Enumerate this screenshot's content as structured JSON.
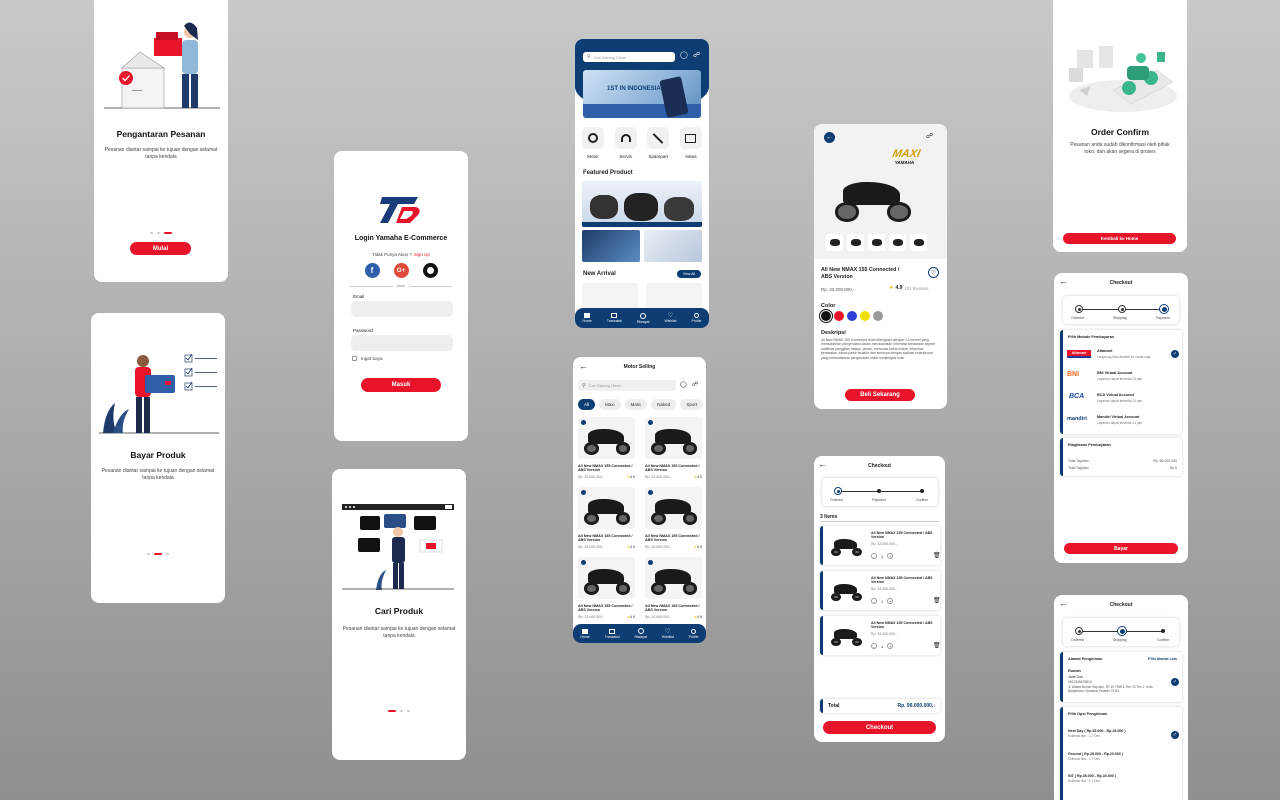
{
  "onboard1": {
    "title": "Pengantaran Pesanan",
    "desc": "Pesanan diantar sampai ke tujuan dengan selamat tanpa kendala",
    "button": "Mulai"
  },
  "onboard2": {
    "title": "Bayar Produk",
    "desc": "Pesanan diantar sampai ke tujuan dengan selamat tanpa kendala"
  },
  "onboard3": {
    "title": "Cari Produk",
    "desc": "Pesanan diantar sampai ke tujuan dengan selamat tanpa kendala"
  },
  "login": {
    "title": "Login Yamaha E-Commerce",
    "no_account": "Tidak Punya Akun ?",
    "signup": "Sign Up",
    "or": "Atau",
    "email_label": "Email",
    "password_label": "Password",
    "remember": "Ingat Saya",
    "button": "Masuk"
  },
  "home": {
    "search_placeholder": "Cari Barang Disini",
    "banner_text": "1ST IN INDONESIA",
    "categories": [
      {
        "label": "Motor",
        "icon": "motorcycle-icon"
      },
      {
        "label": "Servis",
        "icon": "headset-icon"
      },
      {
        "label": "Sparepart",
        "icon": "wrench-icon"
      },
      {
        "label": "News",
        "icon": "newspaper-icon"
      }
    ],
    "featured_title": "Featured Product",
    "new_arrival_title": "New Arrival",
    "view_all": "View All",
    "nav": [
      "Home",
      "Transaksi",
      "Riwayat",
      "Wishlist",
      "Profile"
    ]
  },
  "listing": {
    "title": "Motor Selling",
    "search_placeholder": "Cari Barang Disini",
    "filters": [
      "All",
      "Maxi",
      "Matic",
      "Naked",
      "Sport"
    ],
    "products": [
      {
        "name": "All New NMAX 155 Connected / ABS Version",
        "price": "Rp. 32.000.000,-",
        "rating": "4.9"
      },
      {
        "name": "All New NMAX 155 Connected / ABS Version",
        "price": "Rp. 32.000.000,-",
        "rating": "4.9"
      },
      {
        "name": "All New NMAX 155 Connected / ABS Version",
        "price": "Rp. 32.000.000,-",
        "rating": "4.9"
      },
      {
        "name": "All New NMAX 155 Connected / ABS Version",
        "price": "Rp. 32.000.000,-",
        "rating": "4.9"
      },
      {
        "name": "All New NMAX 155 Connected / ABS Version",
        "price": "Rp. 32.000.000,-",
        "rating": "4.9"
      },
      {
        "name": "All New NMAX 155 Connected / ABS Version",
        "price": "Rp. 32.000.000,-",
        "rating": "4.9"
      }
    ],
    "nav": [
      "Home",
      "Transaksi",
      "Riwayat",
      "Wishlist",
      "Profile"
    ]
  },
  "detail": {
    "brand": "MAXI",
    "brand_sub": "YAMAHA",
    "name": "All New NMAX 155 Connected / ABS Version",
    "price": "Rp. 32.000.000,-",
    "rating": "4.9",
    "reviews": "122 Reviews",
    "color_label": "Color",
    "colors": [
      "#111111",
      "#e8142a",
      "#2d3fd6",
      "#f0e000",
      "#9a9a9a"
    ],
    "desc_label": "Deskripsi",
    "desc": "All New NMAX 155 Connected telah dilengkapi dengan Y-Connect yang memudahkan pengendara dalam mendapatkan informasi kendaraan seperti notifikasi panggilan masuk, pesan, konsumsi bahan bakar, informasi perawatan, lokasi parkir terakhir dan tentunya dengan aplikasi smartphone yang memudahkan pengendara untuk menjelajahi kota.",
    "button": "Beli Sekarang"
  },
  "checkout": {
    "title": "Checkout",
    "steps": [
      "Ordered",
      "Payment",
      "Confirm"
    ],
    "items_label": "3 Items",
    "items": [
      {
        "name": "All New NMAX 155 Connected / ABS Version",
        "price": "Rp. 32.000.000,-",
        "qty": "1"
      },
      {
        "name": "All New NMAX 155 Connected / ABS Version",
        "price": "Rp. 32.000.000,-",
        "qty": "1"
      },
      {
        "name": "All New NMAX 155 Connected / ABS Version",
        "price": "Rp. 32.000.000,-",
        "qty": "1"
      }
    ],
    "total_label": "Total",
    "total": "Rp. 96.000.000,-",
    "button": "Checkout"
  },
  "confirm": {
    "title": "Order Confirm",
    "desc": "Pesanan anda sudah dikonfirmasi oleh pihak toko, dan akan segera di proses",
    "button": "Kembali ke Home"
  },
  "payment": {
    "title": "Checkout",
    "steps": [
      "Ordered",
      "Shipping",
      "Payment"
    ],
    "method_label": "Pilih Metode Pembayaran",
    "methods": [
      {
        "logo": "Alfamart",
        "name": "Alfamart",
        "sub": "Langsung bisa diambil ke mana saja"
      },
      {
        "logo": "BNI",
        "name": "BNI Virtual Account",
        "sub": "Layanan dapat tersedia 24 jam"
      },
      {
        "logo": "BCA",
        "name": "BCA Virtual Account",
        "sub": "Layanan dapat tersedia 24 jam"
      },
      {
        "logo": "mandiri",
        "name": "Mandiri Virtual Account",
        "sub": "Layanan dapat tersedia 24 jam"
      }
    ],
    "summary_label": "Ringkasan Pembayaran",
    "total_bill_label": "Total Tagihan",
    "total_bill": "Rp. 96.000.000",
    "total_bill2_label": "Total Tagihan",
    "total_bill2": "Rp.0",
    "button": "Bayar"
  },
  "shipping": {
    "title": "Checkout",
    "steps": [
      "Ordered",
      "Shipping",
      "Confirm"
    ],
    "address_label": "Alamat Pengiriman",
    "change_address": "Pilih Alamat Lain",
    "address_type": "Rumah",
    "address_name": "Jane Doe",
    "address_phone": "0812345678910",
    "address_line": "Jl. Albeta Nomor Sepuluh, RT.19 / RW.4, Kel. Di Tim 1, Kota Banjarbaru, Sulawesi Selatan 70114",
    "options_label": "Pilih Opsi Pengiriman",
    "options": [
      {
        "name": "Next Day ( Rp.35.000 - Rp.28.000 )",
        "eta": "Estimasi tiba : 1-7 Des"
      },
      {
        "name": "Ground ( Rp.25.000 - Rp.20.000 )",
        "eta": "Estimasi tiba : 1-7 Des"
      },
      {
        "name": "INT ( Rp.35.000 - Rp.30.000 )",
        "eta": "Estimasi tiba : 1-7 Des"
      }
    ]
  }
}
